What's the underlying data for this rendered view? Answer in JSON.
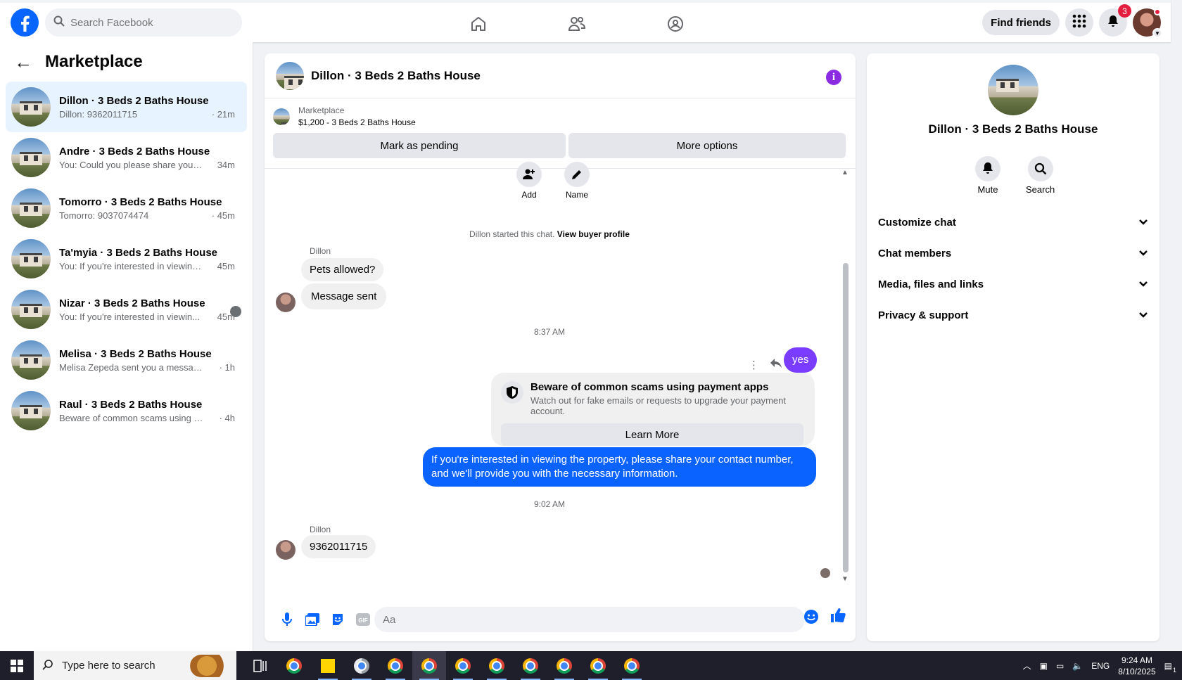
{
  "topbar": {
    "search_placeholder": "Search Facebook",
    "find_friends": "Find friends",
    "notifications_count": "3",
    "brand_color": "#0866ff"
  },
  "sidebar": {
    "title": "Marketplace",
    "conversations": [
      {
        "title": "Dillon · 3 Beds 2 Baths House",
        "preview": "Dillon: 9362011715",
        "time": "· 21m"
      },
      {
        "title": "Andre · 3 Beds 2 Baths House",
        "preview": "You: Could you please share your p...",
        "time": "34m"
      },
      {
        "title": "Tomorro · 3 Beds 2 Baths House",
        "preview": "Tomorro: 9037074474",
        "time": "· 45m"
      },
      {
        "title": "Ta'myia · 3 Beds 2 Baths House",
        "preview": "You: If you're interested in viewing t...",
        "time": "45m"
      },
      {
        "title": "Nizar · 3 Beds 2 Baths House",
        "preview": "You: If you're interested in viewin...",
        "time": "45m"
      },
      {
        "title": "Melisa · 3 Beds 2 Baths House",
        "preview": "Melisa Zepeda sent you a message ab...",
        "time": "· 1h"
      },
      {
        "title": "Raul · 3 Beds 2 Baths House",
        "preview": "Beware of common scams using pay...",
        "time": "· 4h"
      }
    ]
  },
  "chat": {
    "title": "Dillon · 3 Beds 2 Baths House",
    "listing": {
      "source": "Marketplace",
      "price_title": "$1,200 - 3 Beds 2 Baths House",
      "mark_pending": "Mark as pending",
      "more_options": "More options"
    },
    "quick_actions": {
      "add": "Add",
      "name": "Name"
    },
    "started_text": "Dillon started this chat.",
    "view_buyer_profile": "View buyer profile",
    "sender_name": "Dillon",
    "msg1": "Pets allowed?",
    "msg2": "Message sent",
    "time1": "8:37 AM",
    "msg_yes": "yes",
    "scam": {
      "title": "Beware of common scams using payment apps",
      "body": "Watch out for fake emails or requests to upgrade your payment account.",
      "learn_more": "Learn More"
    },
    "msg_out": "If you're interested in viewing the property, please share your contact number, and we'll provide you with the necessary information.",
    "time2": "9:02 AM",
    "sender_name2": "Dillon",
    "msg_phone": "9362011715",
    "composer_placeholder": "Aa"
  },
  "info_panel": {
    "name": "Dillon · 3 Beds 2 Baths House",
    "mute": "Mute",
    "search": "Search",
    "menu": [
      "Customize chat",
      "Chat members",
      "Media, files and links",
      "Privacy & support"
    ]
  },
  "taskbar": {
    "search_placeholder": "Type here to search",
    "language": "ENG",
    "time": "9:24 AM",
    "date": "8/10/2025",
    "notification_count": "1"
  }
}
